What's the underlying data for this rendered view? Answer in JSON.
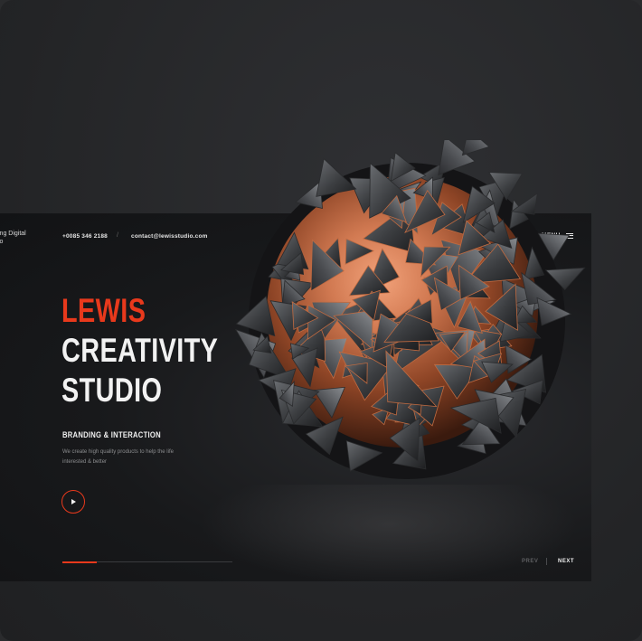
{
  "header": {
    "brand_fragment_line1": "ing Digital",
    "brand_fragment_line2": "io",
    "phone": "+0085 346 2188",
    "separator": "/",
    "email": "contact@lewisstudio.com",
    "menu_label": "MENU"
  },
  "hero": {
    "title_line1": "LEWIS",
    "title_line2": "CREATIVITY",
    "title_line3": "STUDIO",
    "tagline": "BRANDING & INTERACTION",
    "description": "We create high quality products to help the life interested & better"
  },
  "slider": {
    "progress": 0.2,
    "prev_label": "PREV",
    "next_label": "NEXT"
  },
  "colors": {
    "accent": "#e8391c",
    "panel": "#161719",
    "background": "#27282a",
    "copper": "#c8714a"
  },
  "icons": {
    "play": "play-icon",
    "menu": "hamburger-icon",
    "hero_art": "geometric-sphere"
  }
}
